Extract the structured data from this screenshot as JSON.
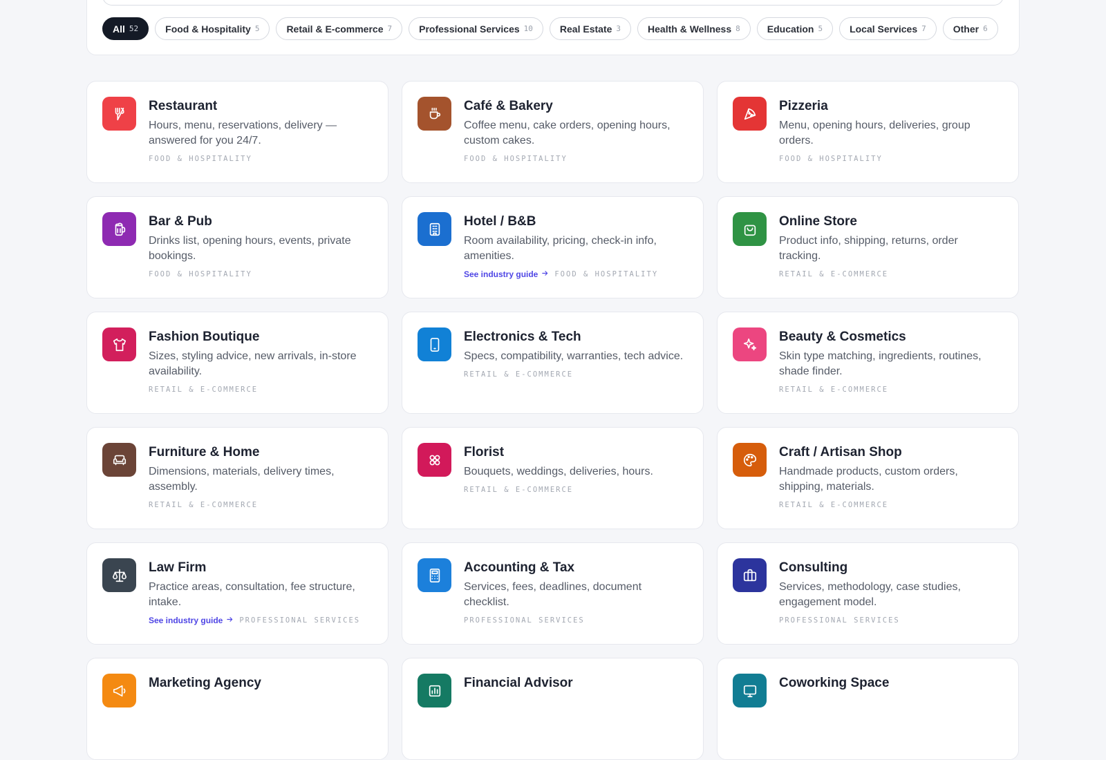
{
  "filters": [
    {
      "label": "All",
      "count": "52",
      "active": true
    },
    {
      "label": "Food & Hospitality",
      "count": "5"
    },
    {
      "label": "Retail & E-commerce",
      "count": "7"
    },
    {
      "label": "Professional Services",
      "count": "10"
    },
    {
      "label": "Real Estate",
      "count": "3"
    },
    {
      "label": "Health & Wellness",
      "count": "8"
    },
    {
      "label": "Education",
      "count": "5"
    },
    {
      "label": "Local Services",
      "count": "7"
    },
    {
      "label": "Other",
      "count": "6"
    }
  ],
  "guide_link": "See industry guide",
  "cards": [
    {
      "title": "Restaurant",
      "desc": "Hours, menu, reservations, delivery — answered for you 24/7.",
      "tag": "FOOD & HOSPITALITY",
      "icon": "utensils-icon",
      "color": "#ef4147"
    },
    {
      "title": "Café & Bakery",
      "desc": "Coffee menu, cake orders, opening hours, custom cakes.",
      "tag": "FOOD & HOSPITALITY",
      "icon": "coffee-cup-icon",
      "color": "#a4532d"
    },
    {
      "title": "Pizzeria",
      "desc": "Menu, opening hours, deliveries, group orders.",
      "tag": "FOOD & HOSPITALITY",
      "icon": "pizza-slice-icon",
      "color": "#e43535"
    },
    {
      "title": "Bar & Pub",
      "desc": "Drinks list, opening hours, events, private bookings.",
      "tag": "FOOD & HOSPITALITY",
      "icon": "beer-mug-icon",
      "color": "#8e2ab2"
    },
    {
      "title": "Hotel / B&B",
      "desc": "Room availability, pricing, check-in info, amenities.",
      "tag": "FOOD & HOSPITALITY",
      "icon": "building-icon",
      "color": "#1b6fd0",
      "guide": true
    },
    {
      "title": "Online Store",
      "desc": "Product info, shipping, returns, order tracking.",
      "tag": "RETAIL & E-COMMERCE",
      "icon": "shopping-bag-icon",
      "color": "#2f9344"
    },
    {
      "title": "Fashion Boutique",
      "desc": "Sizes, styling advice, new arrivals, in-store availability.",
      "tag": "RETAIL & E-COMMERCE",
      "icon": "shirt-icon",
      "color": "#d21f5c"
    },
    {
      "title": "Electronics & Tech",
      "desc": "Specs, compatibility, warranties, tech advice.",
      "tag": "RETAIL & E-COMMERCE",
      "icon": "smartphone-icon",
      "color": "#1181d6"
    },
    {
      "title": "Beauty & Cosmetics",
      "desc": "Skin type matching, ingredients, routines, shade finder.",
      "tag": "RETAIL & E-COMMERCE",
      "icon": "sparkles-icon",
      "color": "#ec4680"
    },
    {
      "title": "Furniture & Home",
      "desc": "Dimensions, materials, delivery times, assembly.",
      "tag": "RETAIL & E-COMMERCE",
      "icon": "sofa-icon",
      "color": "#6b4437"
    },
    {
      "title": "Florist",
      "desc": "Bouquets, weddings, deliveries, hours.",
      "tag": "RETAIL & E-COMMERCE",
      "icon": "flower-icon",
      "color": "#d2195a"
    },
    {
      "title": "Craft / Artisan Shop",
      "desc": "Handmade products, custom orders, shipping, materials.",
      "tag": "RETAIL & E-COMMERCE",
      "icon": "palette-icon",
      "color": "#d65d0b"
    },
    {
      "title": "Law Firm",
      "desc": "Practice areas, consultation, fee structure, intake.",
      "tag": "PROFESSIONAL SERVICES",
      "icon": "scales-icon",
      "color": "#3a4550",
      "guide": true
    },
    {
      "title": "Accounting & Tax",
      "desc": "Services, fees, deadlines, document checklist.",
      "tag": "PROFESSIONAL SERVICES",
      "icon": "calculator-icon",
      "color": "#1c80db"
    },
    {
      "title": "Consulting",
      "desc": "Services, methodology, case studies, engagement model.",
      "tag": "PROFESSIONAL SERVICES",
      "icon": "briefcase-icon",
      "color": "#2c349d"
    },
    {
      "title": "Marketing Agency",
      "desc": "",
      "tag": "",
      "icon": "megaphone-icon",
      "color": "#f48a12"
    },
    {
      "title": "Financial Advisor",
      "desc": "",
      "tag": "",
      "icon": "chart-icon",
      "color": "#157a63"
    },
    {
      "title": "Coworking Space",
      "desc": "",
      "tag": "",
      "icon": "monitor-icon",
      "color": "#117d93"
    }
  ]
}
